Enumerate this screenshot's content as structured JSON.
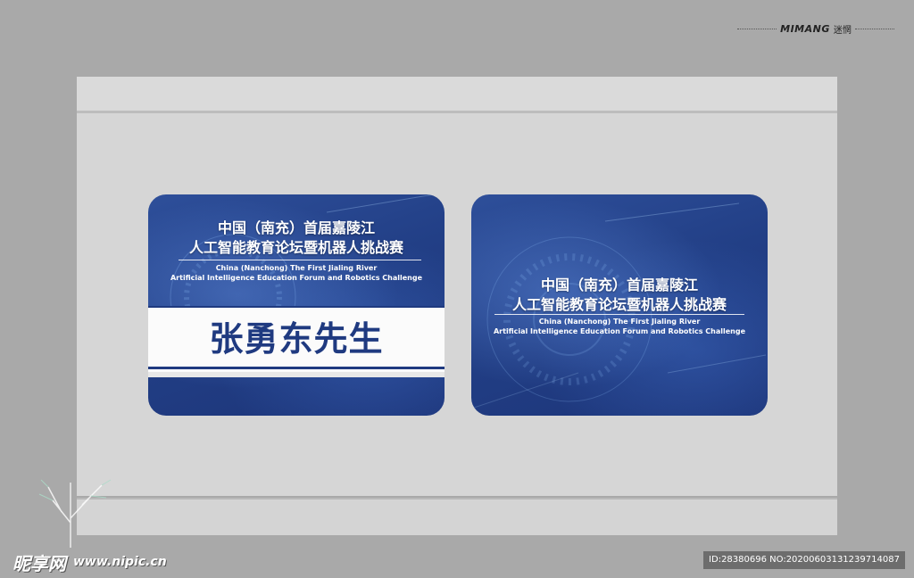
{
  "brand": {
    "en": "MIMANG",
    "cn": "迷惘"
  },
  "cards": {
    "title_line1": "中国（南充）首届嘉陵江",
    "title_line2": "人工智能教育论坛暨机器人挑战赛",
    "en_line1": "China (Nanchong) The First Jialing River",
    "en_line2": "Artificial Intelligence Education Forum and Robotics Challenge",
    "name": "张勇东先生"
  },
  "watermark": {
    "site_cn": "昵享网",
    "url": "www.nipic.cn",
    "id": "ID:28380696 NO:20200603131239714087"
  },
  "colors": {
    "card_blue": "#223f86",
    "name_blue": "#1f3a80",
    "background": "#a9a9a9"
  }
}
